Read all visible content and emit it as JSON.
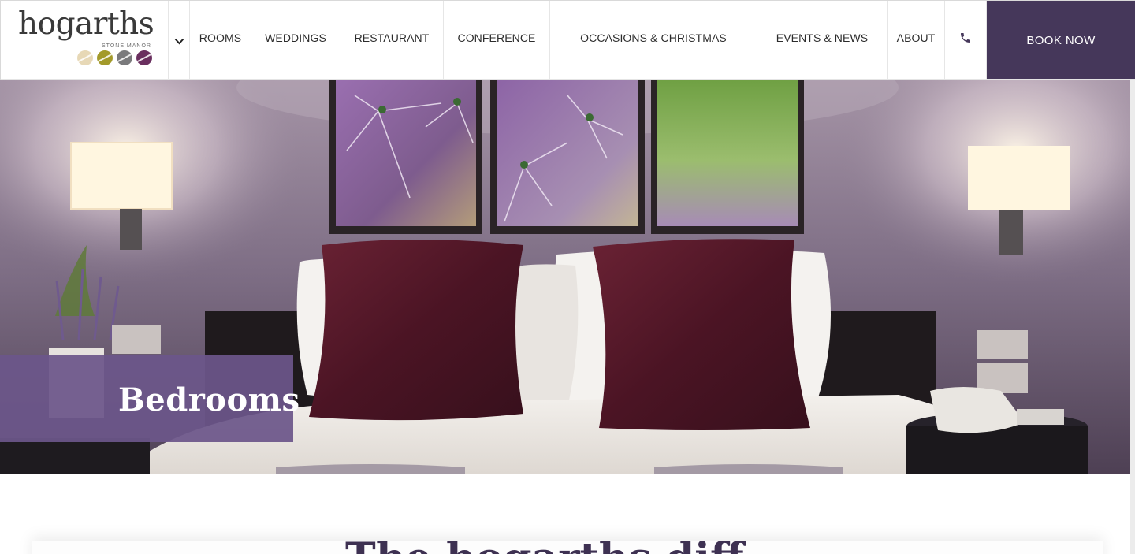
{
  "brand": {
    "name": "hogarths",
    "subtitle": "STONE MANOR",
    "dot_colors": [
      "#e7d8b6",
      "#a39a2a",
      "#7a7a7c",
      "#6a2f5f"
    ]
  },
  "nav": {
    "items": [
      {
        "label": "ROOMS"
      },
      {
        "label": "WEDDINGS"
      },
      {
        "label": "RESTAURANT"
      },
      {
        "label": "CONFERENCE"
      },
      {
        "label": "OCCASIONS & CHRISTMAS"
      },
      {
        "label": "EVENTS & NEWS"
      },
      {
        "label": "ABOUT"
      }
    ],
    "book_label": "BOOK NOW",
    "book_color": "#45375a"
  },
  "hero": {
    "title": "Bedrooms",
    "box_color": "#6c568a"
  },
  "content": {
    "heading": "The hogarths diff..."
  },
  "icons": {
    "menu": "chevron-down-icon",
    "phone": "phone-icon"
  }
}
